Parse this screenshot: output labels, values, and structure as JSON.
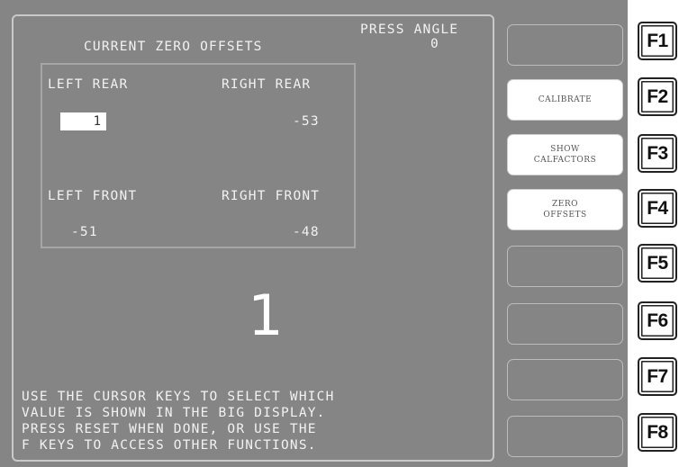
{
  "header": {
    "title": "CURRENT ZERO OFFSETS",
    "press_angle_label": "PRESS ANGLE",
    "press_angle_value": "0"
  },
  "offsets": {
    "left_rear_label": "LEFT REAR",
    "left_rear_value": "1",
    "right_rear_label": "RIGHT REAR",
    "right_rear_value": "-53",
    "left_front_label": "LEFT FRONT",
    "left_front_value": "-51",
    "right_front_label": "RIGHT FRONT",
    "right_front_value": "-48"
  },
  "big_display": {
    "value": "1"
  },
  "instructions": {
    "line1": "USE THE CURSOR KEYS TO SELECT WHICH",
    "line2": "VALUE IS SHOWN IN THE BIG DISPLAY.",
    "line3": "PRESS RESET WHEN DONE, OR USE THE",
    "line4": "F KEYS TO ACCESS OTHER FUNCTIONS."
  },
  "softkeys": [
    {
      "key": "F1",
      "label": ""
    },
    {
      "key": "F2",
      "label": "CALIBRATE"
    },
    {
      "key": "F3",
      "label": "SHOW\nCALFACTORS"
    },
    {
      "key": "F4",
      "label": "ZERO\nOFFSETS"
    },
    {
      "key": "F5",
      "label": ""
    },
    {
      "key": "F6",
      "label": ""
    },
    {
      "key": "F7",
      "label": ""
    },
    {
      "key": "F8",
      "label": ""
    }
  ],
  "colors": {
    "screen_bg": "#858585",
    "text": "#f2f2f2",
    "active_softkey_bg": "#ffffff"
  }
}
